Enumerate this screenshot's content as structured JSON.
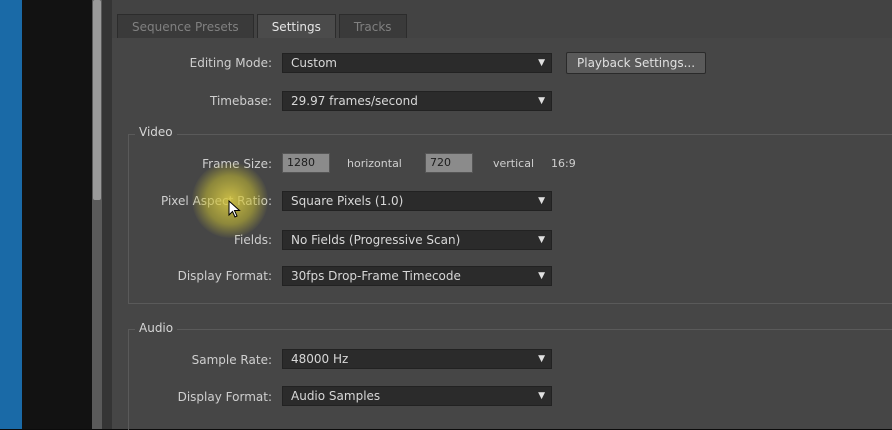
{
  "tabs": [
    {
      "label": "Sequence Presets",
      "active": false
    },
    {
      "label": "Settings",
      "active": true
    },
    {
      "label": "Tracks",
      "active": false
    }
  ],
  "editing_mode": {
    "label": "Editing Mode:",
    "value": "Custom"
  },
  "playback_button": {
    "label": "Playback Settings..."
  },
  "timebase": {
    "label": "Timebase:",
    "value": "29.97 frames/second"
  },
  "video": {
    "title": "Video",
    "frame_size": {
      "label": "Frame Size:",
      "horizontal_value": "1280",
      "horizontal_label": "horizontal",
      "vertical_value": "720",
      "vertical_label": "vertical",
      "aspect": "16:9"
    },
    "pixel_aspect": {
      "label": "Pixel Aspect Ratio:",
      "value": "Square Pixels (1.0)"
    },
    "fields": {
      "label": "Fields:",
      "value": "No Fields (Progressive Scan)"
    },
    "display_format": {
      "label": "Display Format:",
      "value": "30fps Drop-Frame Timecode"
    }
  },
  "audio": {
    "title": "Audio",
    "sample_rate": {
      "label": "Sample Rate:",
      "value": "48000 Hz"
    },
    "display_format": {
      "label": "Display Format:",
      "value": "Audio Samples"
    }
  },
  "icons": {
    "dropdown_arrow": "dropdown-arrow-icon",
    "cursor": "mouse-cursor-icon"
  }
}
